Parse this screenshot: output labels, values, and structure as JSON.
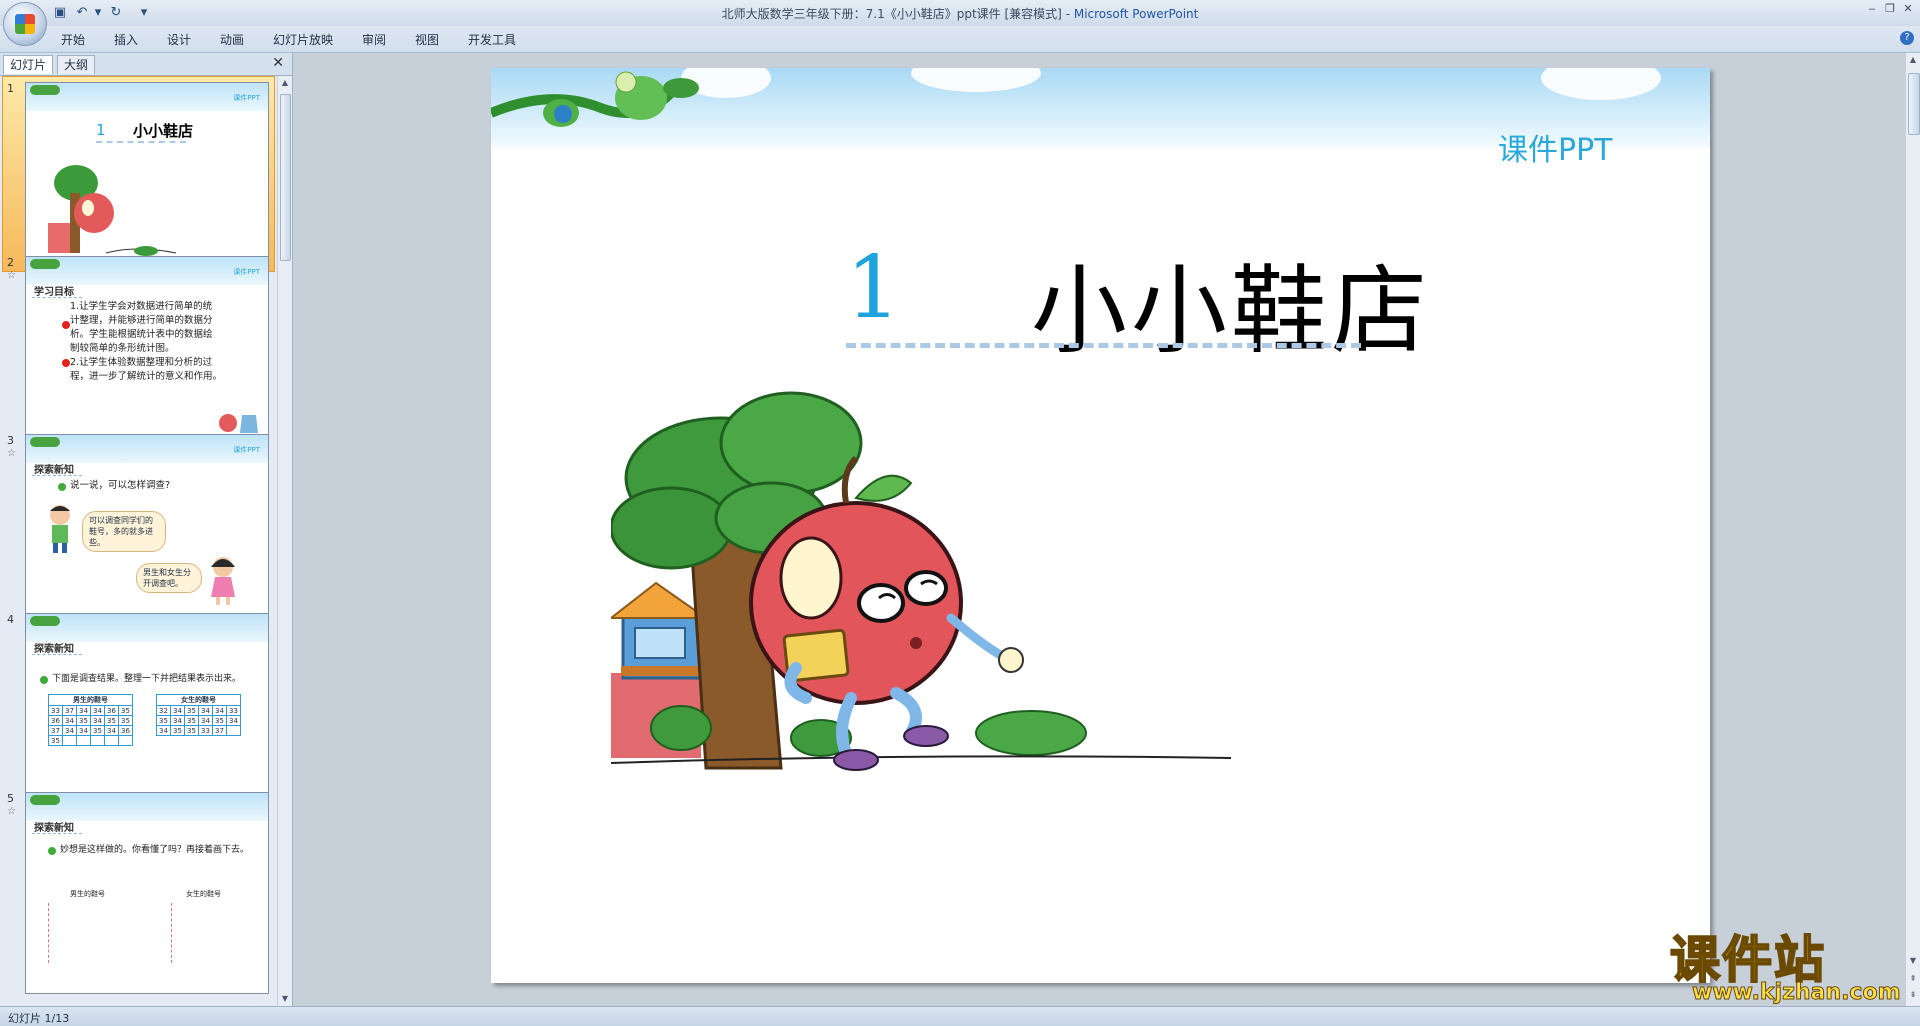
{
  "window": {
    "title": "北师大版数学三年级下册：7.1《小小鞋店》ppt课件 [兼容模式]",
    "app_name": "Microsoft PowerPoint"
  },
  "menu": {
    "items": [
      "开始",
      "插入",
      "设计",
      "动画",
      "幻灯片放映",
      "审阅",
      "视图",
      "开发工具"
    ]
  },
  "panel": {
    "tabs": [
      "幻灯片",
      "大纲"
    ],
    "close_label": "✕"
  },
  "thumbnails": [
    {
      "number": "1",
      "title_num": "1",
      "title": "小小鞋店",
      "brand": "课件PPT"
    },
    {
      "number": "2",
      "brand": "课件PPT",
      "heading": "学习目标",
      "lines": [
        "1.让学生学会对数据进行简单的统",
        "计整理，并能够进行简单的数据分",
        "析。学生能根据统计表中的数据绘",
        "制较简单的条形统计图。",
        "2.让学生体验数据整理和分析的过",
        "程，进一步了解统计的意义和作用。"
      ]
    },
    {
      "number": "3",
      "brand": "课件PPT",
      "heading": "探索新知",
      "prompt": "说一说，可以怎样调查?",
      "bubble1": "可以调查同学们的鞋号，多的就多进些。",
      "bubble2": "男生和女生分开调查吧。"
    },
    {
      "number": "4",
      "heading": "探索新知",
      "prompt": "下面是调查结果。整理一下并把结果表示出来。",
      "table_boys_title": "男生的鞋号",
      "table_girls_title": "女生的鞋号",
      "boys": [
        [
          "33",
          "37",
          "34",
          "34",
          "36",
          "35"
        ],
        [
          "36",
          "34",
          "35",
          "34",
          "35",
          "35"
        ],
        [
          "37",
          "34",
          "34",
          "35",
          "34",
          "36"
        ],
        [
          "35",
          "",
          "",
          "",
          "",
          ""
        ]
      ],
      "girls": [
        [
          "32",
          "34",
          "35",
          "34",
          "34",
          "33"
        ],
        [
          "35",
          "34",
          "35",
          "34",
          "35",
          "34"
        ],
        [
          "34",
          "35",
          "35",
          "33",
          "37",
          ""
        ]
      ]
    },
    {
      "number": "5",
      "heading": "探索新知",
      "prompt": "妙想是这样做的。你看懂了吗？再接着画下去。",
      "label_boys": "男生的鞋号",
      "label_girls": "女生的鞋号"
    }
  ],
  "slide": {
    "brand": "课件PPT",
    "number": "1",
    "title": "小小鞋店"
  },
  "status": {
    "text": "幻灯片 1/13"
  },
  "watermark": {
    "text": "课件站",
    "url": "www.kjzhan.com"
  },
  "colors": {
    "accent_blue": "#1fa3de",
    "selected_thumb": "#f6b95b",
    "ribbon": "#d2deec"
  }
}
